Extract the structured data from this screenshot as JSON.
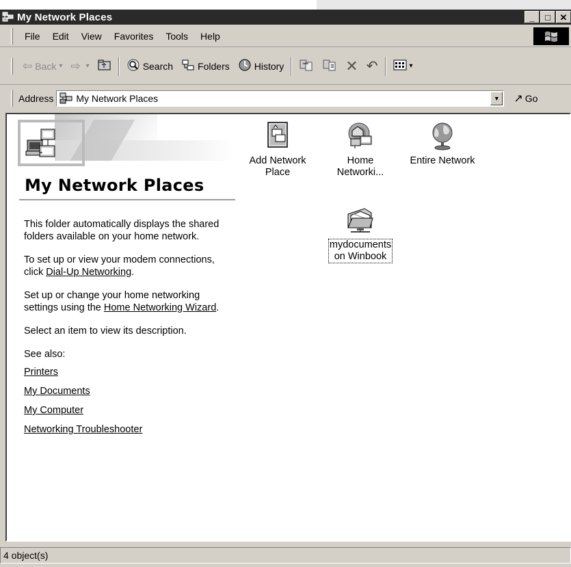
{
  "window": {
    "title": "My Network Places",
    "min_glyph": "_",
    "max_glyph": "□",
    "close_glyph": "✕"
  },
  "menubar": {
    "items": [
      "File",
      "Edit",
      "View",
      "Favorites",
      "Tools",
      "Help"
    ]
  },
  "toolbar": {
    "back": "Back",
    "search": "Search",
    "folders": "Folders",
    "history": "History"
  },
  "address": {
    "label": "Address",
    "value": "My Network Places",
    "go": "Go"
  },
  "panel": {
    "title": "My Network Places",
    "p1": "This folder automatically displays the shared folders available on your home network.",
    "p2_prefix": "To set up or view your modem connections, click ",
    "p2_link": "Dial-Up Networking",
    "p2_suffix": ".",
    "p3_prefix": "Set up or change your home networking settings using the ",
    "p3_link": "Home Networking Wizard",
    "p3_suffix": ".",
    "p4": "Select an item to view its description.",
    "see_also": "See also:",
    "links": [
      "Printers",
      "My Documents",
      "My Computer",
      "Networking Troubleshooter"
    ]
  },
  "items": [
    {
      "line1": "Add Network",
      "line2": "Place",
      "icon": "add-network-place-icon"
    },
    {
      "line1": "Home",
      "line2": "Networki...",
      "icon": "home-networking-icon"
    },
    {
      "line1": "Entire Network",
      "line2": "",
      "icon": "globe-icon"
    },
    {
      "line1": "mydocuments",
      "line2": "on Winbook",
      "icon": "shared-folder-icon"
    }
  ],
  "status": {
    "text": "4 object(s)"
  }
}
